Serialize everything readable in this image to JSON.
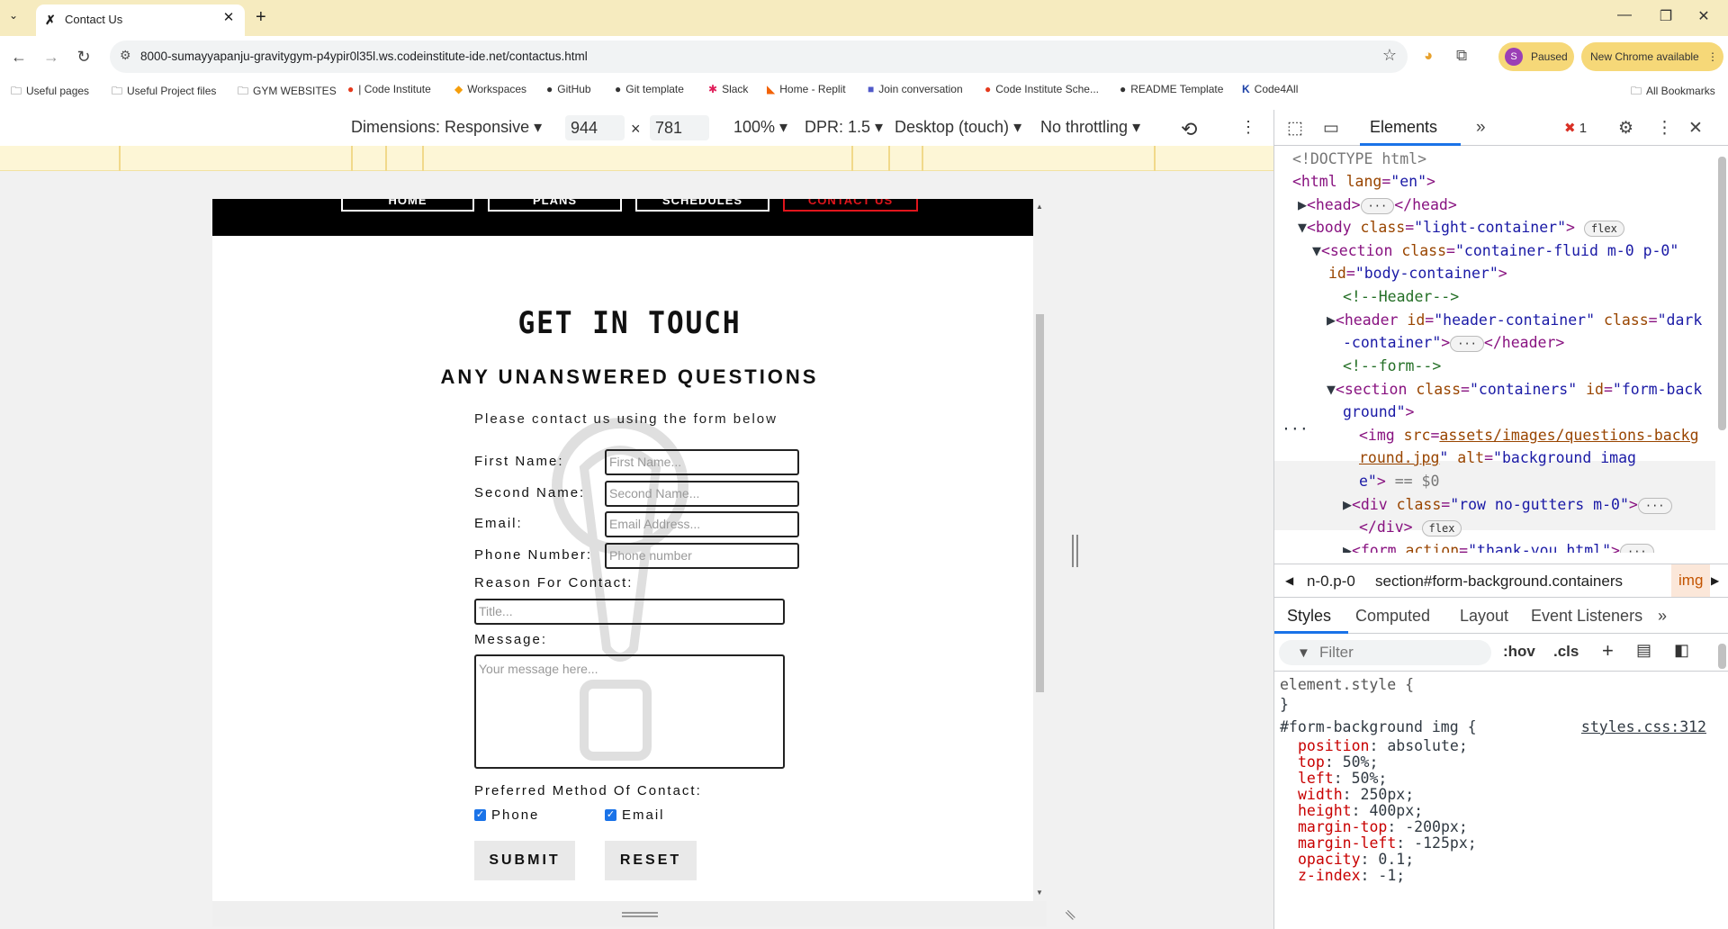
{
  "browser": {
    "tab_title": "Contact Us",
    "url": "8000-sumayyapanju-gravitygym-p4ypir0l35l.ws.codeinstitute-ide.net/contactus.html",
    "profile_initial": "S",
    "profile_status": "Paused",
    "update_label": "New Chrome available"
  },
  "bookmarks": [
    {
      "label": "Useful pages",
      "icon": "folder-icon"
    },
    {
      "label": "Useful Project files",
      "icon": "folder-icon"
    },
    {
      "label": "GYM WEBSITES",
      "icon": "folder-icon"
    },
    {
      "label": "| Code Institute",
      "icon": "code-institute-icon"
    },
    {
      "label": "Workspaces",
      "icon": "gitpod-icon"
    },
    {
      "label": "GitHub",
      "icon": "github-icon"
    },
    {
      "label": "Git template",
      "icon": "github-icon"
    },
    {
      "label": "Slack",
      "icon": "slack-icon"
    },
    {
      "label": "Home - Replit",
      "icon": "replit-icon"
    },
    {
      "label": "Join conversation",
      "icon": "teams-icon"
    },
    {
      "label": "Code Institute Sche...",
      "icon": "code-institute-icon"
    },
    {
      "label": "README Template",
      "icon": "github-icon"
    },
    {
      "label": "Code4All",
      "icon": "k-icon"
    }
  ],
  "all_bookmarks": "All Bookmarks",
  "device_toolbar": {
    "dimensions": "Dimensions: Responsive",
    "width": "944",
    "times": "×",
    "height": "781",
    "zoom": "100%",
    "dpr": "DPR: 1.5",
    "device_type": "Desktop (touch)",
    "throttling": "No throttling"
  },
  "site": {
    "nav": [
      "HOME",
      "PLANS",
      "SCHEDULES",
      "CONTACT US"
    ],
    "heading": "GET IN TOUCH",
    "subheading": "ANY UNANSWERED QUESTIONS",
    "note": "Please contact us using the form below",
    "labels": {
      "first_name": "First Name:",
      "second_name": "Second Name:",
      "email": "Email:",
      "phone": "Phone Number:",
      "reason": "Reason For Contact:",
      "message": "Message:",
      "preferred": "Preferred Method Of Contact:"
    },
    "placeholders": {
      "first_name": "First Name...",
      "second_name": "Second Name...",
      "email": "Email Address...",
      "phone": "Phone number",
      "reason": "Title...",
      "message": "Your message here..."
    },
    "checkboxes": [
      {
        "label": "Phone",
        "checked": true
      },
      {
        "label": "Email",
        "checked": true
      }
    ],
    "submit": "SUBMIT",
    "reset": "RESET"
  },
  "devtools": {
    "active_tab": "Elements",
    "more_tabs": "»",
    "error_count": "1",
    "dom": {
      "doctype": "<!DOCTYPE html>",
      "html_open": "<html ",
      "lang_attr": "lang",
      "lang_val": "\"en\"",
      "head": "<head>",
      "head_close": "</head>",
      "body": "<body ",
      "body_class": "class",
      "body_class_val": "\"light-container\"",
      "flex": "flex",
      "section": "<section ",
      "sec_class": "class",
      "sec_class_val": "\"container-fluid m-0 p-0\"",
      "sec_id": "id",
      "sec_id_val": "\"body-container\"",
      "comment_header": "<!--Header-->",
      "header": "<header ",
      "header_id": "id",
      "header_id_val": "\"header-container\"",
      "header_class": "class",
      "header_class_val_1": "\"dark",
      "header_class_val_2": "-container\"",
      "header_close": "</header>",
      "comment_form": "<!--form-->",
      "section2": "<section ",
      "sec2_class": "class",
      "sec2_class_val": "\"containers\"",
      "sec2_id": "id",
      "sec2_id_val_1": "\"form-back",
      "sec2_id_val_2": "ground\"",
      "img": "<img ",
      "img_src": "src",
      "img_src_val_1": "assets/images/questions-backg",
      "img_src_val_2": "round.jpg",
      "img_alt": "alt",
      "img_alt_val_1": "\"background imag",
      "img_alt_val_2": "e\"",
      "eq": "== $0",
      "div": "<div ",
      "div_class": "class",
      "div_class_val": "\"row no-gutters m-0\"",
      "div_close": "</div>",
      "form": "<form ",
      "form_action": "action",
      "form_action_val": "\"thank-you.html\""
    },
    "breadcrumbs": [
      "n-0.p-0",
      "section#form-background.containers",
      "img"
    ],
    "subtabs": [
      "Styles",
      "Computed",
      "Layout",
      "Event Listeners"
    ],
    "filter_placeholder": "Filter",
    "filter_tools": [
      ":hov",
      ".cls"
    ],
    "styles": {
      "element_style": "element.style {",
      "close": "}",
      "rule_selector": "#form-background img {",
      "rule_source": "styles.css:312",
      "props": [
        {
          "name": "position",
          "value": "absolute;"
        },
        {
          "name": "top",
          "value": "50%;"
        },
        {
          "name": "left",
          "value": "50%;"
        },
        {
          "name": "width",
          "value": "250px;"
        },
        {
          "name": "height",
          "value": "400px;"
        },
        {
          "name": "margin-top",
          "value": "-200px;"
        },
        {
          "name": "margin-left",
          "value": "-125px;"
        },
        {
          "name": "opacity",
          "value": "0.1;"
        },
        {
          "name": "z-index",
          "value": "-1;"
        }
      ]
    }
  }
}
